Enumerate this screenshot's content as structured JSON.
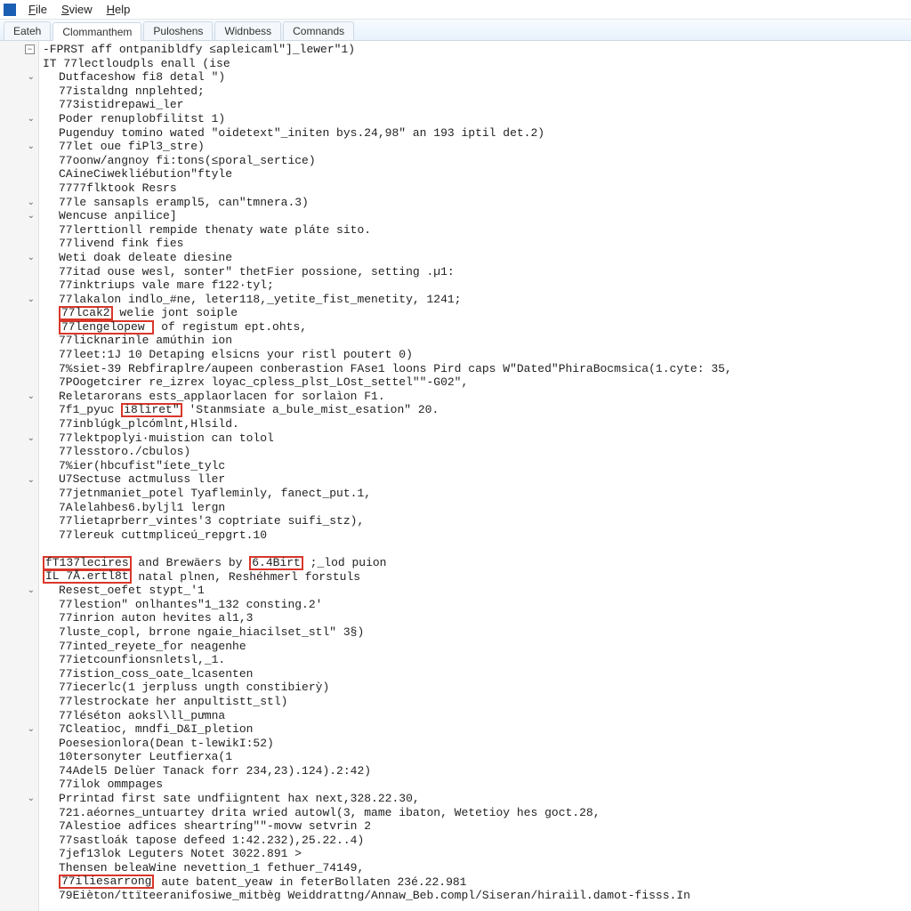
{
  "menubar": {
    "items": [
      "File",
      "Sview",
      "Help"
    ],
    "underline_idx": [
      0,
      0,
      0
    ]
  },
  "tabs": [
    {
      "label": "Eateh",
      "active": false
    },
    {
      "label": "Clommanthem",
      "active": true
    },
    {
      "label": "Puloshens",
      "active": false
    },
    {
      "label": "Widnbess",
      "active": false
    },
    {
      "label": "Comnands",
      "active": false
    }
  ],
  "lines": [
    {
      "fold": "minus",
      "indent": 0,
      "segs": [
        {
          "t": "-FPRST aff ontpanibldfy ≤apleicaml\"]_lewer\"1)"
        }
      ]
    },
    {
      "fold": "",
      "indent": 0,
      "segs": [
        {
          "t": "IT 77lectloudpls enall (ise"
        }
      ]
    },
    {
      "fold": "chev",
      "indent": 1,
      "segs": [
        {
          "t": "Dutfaceshow fi8 detal \")"
        }
      ]
    },
    {
      "fold": "",
      "indent": 1,
      "segs": [
        {
          "t": "77istaldng nnplehted;"
        }
      ]
    },
    {
      "fold": "",
      "indent": 1,
      "segs": [
        {
          "t": "773istidrepawi_ler"
        }
      ]
    },
    {
      "fold": "chev",
      "indent": 1,
      "segs": [
        {
          "t": "Poder renuplobfilitst 1)"
        }
      ]
    },
    {
      "fold": "",
      "indent": 1,
      "segs": [
        {
          "t": "Pugenduy tomino wated \"oidetext\"_initen bys.24,98\" an 193 iptil det.2)"
        }
      ]
    },
    {
      "fold": "chev",
      "indent": 1,
      "segs": [
        {
          "t": "77let oue fiPl3_stre)"
        }
      ]
    },
    {
      "fold": "",
      "indent": 1,
      "segs": [
        {
          "t": "77oonw/angnoy fi:tons(≤poral_sertice)"
        }
      ]
    },
    {
      "fold": "",
      "indent": 1,
      "segs": [
        {
          "t": "CAineCiwekliébution\"ftyle"
        }
      ]
    },
    {
      "fold": "",
      "indent": 1,
      "segs": [
        {
          "t": "7777flktook Resrs"
        }
      ]
    },
    {
      "fold": "chev",
      "indent": 1,
      "segs": [
        {
          "t": "77le sansapls erampl5, can\"tmnera.3)"
        }
      ]
    },
    {
      "fold": "chev",
      "indent": 1,
      "segs": [
        {
          "t": "Wencuse anpilice]"
        }
      ]
    },
    {
      "fold": "",
      "indent": 1,
      "segs": [
        {
          "t": "77lerttionll rempide thenaty wate pláte sito."
        }
      ]
    },
    {
      "fold": "",
      "indent": 1,
      "segs": [
        {
          "t": "77livend fink fies"
        }
      ]
    },
    {
      "fold": "chev",
      "indent": 1,
      "segs": [
        {
          "t": "Weti doak deleate diesine"
        }
      ]
    },
    {
      "fold": "",
      "indent": 1,
      "segs": [
        {
          "t": "77itad ouse wesl, sonter\" thetFier possione, setting .µ1:"
        }
      ]
    },
    {
      "fold": "",
      "indent": 1,
      "segs": [
        {
          "t": "77inktriups vale mare f122·tyl;"
        }
      ]
    },
    {
      "fold": "chev",
      "indent": 1,
      "segs": [
        {
          "t": "77lakalon indlo_#ne, leter118,_yetite_fist_menetity, 1241;"
        }
      ]
    },
    {
      "fold": "",
      "indent": 1,
      "segs": [
        {
          "t": "77lcak2",
          "hl": true
        },
        {
          "t": " welie jont soiple"
        }
      ]
    },
    {
      "fold": "",
      "indent": 1,
      "segs": [
        {
          "t": "77lengelopew ",
          "hl": true
        },
        {
          "t": " of registum ept.ohts,"
        }
      ]
    },
    {
      "fold": "",
      "indent": 1,
      "segs": [
        {
          "t": "77licknarinle amúthin ion"
        }
      ]
    },
    {
      "fold": "",
      "indent": 1,
      "segs": [
        {
          "t": "77leet:1J 10 Detaping elsicns your ristl poutert 0)"
        }
      ]
    },
    {
      "fold": "",
      "indent": 1,
      "segs": [
        {
          "t": "7%siet-39 Rebfiraplre/aupeen conberastion FAse1 loons Pird caps W\"Dated\"PhiraBocmsica(1.cyte: 35,"
        }
      ]
    },
    {
      "fold": "",
      "indent": 1,
      "segs": [
        {
          "t": "7POogetcirer re_izrex loyac_cpless_plst_LOst_settel\"\"-G02\","
        }
      ]
    },
    {
      "fold": "chev",
      "indent": 1,
      "segs": [
        {
          "t": "Reletarorans ests_applaorlacen for sorlaìon F1."
        }
      ]
    },
    {
      "fold": "",
      "indent": 1,
      "segs": [
        {
          "t": "7f1_pyuc "
        },
        {
          "t": "i8liret\"",
          "hl": true
        },
        {
          "t": " 'Stanmsiate a_bule_mist_esation\" 20."
        }
      ]
    },
    {
      "fold": "",
      "indent": 1,
      "segs": [
        {
          "t": "77inblúgk_plcómlnt,Hlsild."
        }
      ]
    },
    {
      "fold": "chev",
      "indent": 1,
      "segs": [
        {
          "t": "77lektpoplyi·muistion can tolol"
        }
      ]
    },
    {
      "fold": "",
      "indent": 1,
      "segs": [
        {
          "t": "77lesstoro./cbulos)"
        }
      ]
    },
    {
      "fold": "",
      "indent": 1,
      "segs": [
        {
          "t": "7%ier(hbcufist\"íete_tylc"
        }
      ]
    },
    {
      "fold": "chev",
      "indent": 1,
      "segs": [
        {
          "t": "U7Sectuse actmuluss ller"
        }
      ]
    },
    {
      "fold": "",
      "indent": 1,
      "segs": [
        {
          "t": "77jetnmaniet_potel Tyafleminly, fanect_put.1,"
        }
      ]
    },
    {
      "fold": "",
      "indent": 1,
      "segs": [
        {
          "t": "7Alelahbes6.byljl1 lergn"
        }
      ]
    },
    {
      "fold": "",
      "indent": 1,
      "segs": [
        {
          "t": "77lietaprberr_vintes'3 coptriate suifi_stz),"
        }
      ]
    },
    {
      "fold": "",
      "indent": 1,
      "segs": [
        {
          "t": "77lereuk cuttmpliceú_repgrt.10"
        }
      ]
    },
    {
      "fold": "",
      "indent": 1,
      "segs": [
        {
          "t": ""
        }
      ]
    },
    {
      "fold": "",
      "indent": 0,
      "segs": [
        {
          "t": "fT137lecires",
          "hl": true
        },
        {
          "t": " and Brewäers by "
        },
        {
          "t": "6.4Birt",
          "hl": true
        },
        {
          "t": " ;_lod puion"
        }
      ]
    },
    {
      "fold": "",
      "indent": 0,
      "segs": [
        {
          "t": "IL 7Å.ertl8t",
          "hl": true
        },
        {
          "t": " natal plnen, Reshéhmerl forstuls"
        }
      ]
    },
    {
      "fold": "chev",
      "indent": 1,
      "segs": [
        {
          "t": "Resest_oefet stypt_'1"
        }
      ]
    },
    {
      "fold": "",
      "indent": 1,
      "segs": [
        {
          "t": "77lestion\" onlhantes\"1_132 consting.2'"
        }
      ]
    },
    {
      "fold": "",
      "indent": 1,
      "segs": [
        {
          "t": "77inrion auton hevites al1,3"
        }
      ]
    },
    {
      "fold": "",
      "indent": 1,
      "segs": [
        {
          "t": "7luste_copl, brrone ngaie_hiacilset_stl\" 3§)"
        }
      ]
    },
    {
      "fold": "",
      "indent": 1,
      "segs": [
        {
          "t": "77inted_reyete_for neagenhe"
        }
      ]
    },
    {
      "fold": "",
      "indent": 1,
      "segs": [
        {
          "t": "77ietcounfionsnletsl,_1."
        }
      ]
    },
    {
      "fold": "",
      "indent": 1,
      "segs": [
        {
          "t": "77istion_coss_oate_lcasenten"
        }
      ]
    },
    {
      "fold": "",
      "indent": 1,
      "segs": [
        {
          "t": "77iecerlc(1 jerpluss ungth constibierỳ)"
        }
      ]
    },
    {
      "fold": "",
      "indent": 1,
      "segs": [
        {
          "t": "77lestrockate her anpultistt_stl)"
        }
      ]
    },
    {
      "fold": "",
      "indent": 1,
      "segs": [
        {
          "t": "77léséton aoksl\\ll_pưmna"
        }
      ]
    },
    {
      "fold": "chev",
      "indent": 1,
      "segs": [
        {
          "t": "7Cleatioc, mndfi_D&I_pletion"
        }
      ]
    },
    {
      "fold": "",
      "indent": 1,
      "segs": [
        {
          "t": "Poesesionlora(Dean t-lewikI:52)"
        }
      ]
    },
    {
      "fold": "",
      "indent": 1,
      "segs": [
        {
          "t": "10tersonyter Leutfierxa(1"
        }
      ]
    },
    {
      "fold": "",
      "indent": 1,
      "segs": [
        {
          "t": "74Adel5 Delùer Tanack forr 234,23).124).2:42)"
        }
      ]
    },
    {
      "fold": "",
      "indent": 1,
      "segs": [
        {
          "t": "77ilok ommpages"
        }
      ]
    },
    {
      "fold": "chev",
      "indent": 1,
      "segs": [
        {
          "t": "Prrintad first sate undfiigntent hax next,328.22.30,"
        }
      ]
    },
    {
      "fold": "",
      "indent": 1,
      "segs": [
        {
          "t": "721.aéornes_untuartey drita wried autowl(3, mame ibaton, Wetetioy hes goct.28,"
        }
      ]
    },
    {
      "fold": "",
      "indent": 1,
      "segs": [
        {
          "t": "7Alestioe adfices sheartríng\"\"-movw setvrin 2"
        }
      ]
    },
    {
      "fold": "",
      "indent": 1,
      "segs": [
        {
          "t": "77sastloák tapose defeed 1:42.232),25.22..4)"
        }
      ]
    },
    {
      "fold": "",
      "indent": 1,
      "segs": [
        {
          "t": "7jef13lok Leguters Notet 3022.891 >"
        }
      ]
    },
    {
      "fold": "",
      "indent": 1,
      "segs": [
        {
          "t": "Thensen beleaWine nevettion_1 fethuer_74149,"
        }
      ]
    },
    {
      "fold": "",
      "indent": 1,
      "segs": [
        {
          "t": "77iliesarrong",
          "hl": true
        },
        {
          "t": " aute batent_yeaw in feterBollaten 23é.22.981"
        }
      ]
    },
    {
      "fold": "",
      "indent": 1,
      "segs": [
        {
          "t": "79Eièton/ttïteeranifosiwe_mitbèg Weiddrattng/Annaw_Beb.compl/Siseran/hiraiìl.damot-fisss.In"
        }
      ]
    }
  ]
}
